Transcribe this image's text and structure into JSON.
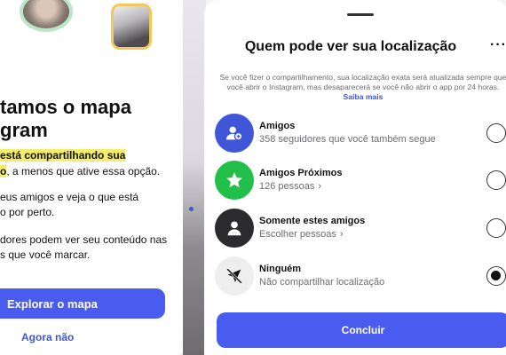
{
  "left_panel": {
    "title_line1": "tamos o mapa",
    "title_line2": "gram",
    "p1_highlight_1": "está compartilhando sua",
    "p1_highlight_2": "o",
    "p1_rest": ", a menos que ative essa opção.",
    "p2_line1": "eus amigos e veja o que está",
    "p2_line2": "o por perto.",
    "p3_line1": "dores podem ver seu conteúdo nas",
    "p3_line2": "s que você marcar.",
    "primary_button": "Explorar o mapa",
    "secondary_link": "Agora não"
  },
  "sheet": {
    "title": "Quem pode ver sua localização",
    "more_label": "···",
    "description": "Se você fizer o compartilhamento, sua localização exata será atualizada sempre que você abrir o Instagram, mas desaparecerá se você não abrir o app por 24 horas.",
    "learn_more": "Saiba mais",
    "options": [
      {
        "title": "Amigos",
        "subtitle": "358 seguidores que você também segue",
        "icon": "people-icon",
        "color": "#3f56d8",
        "selected": false
      },
      {
        "title": "Amigos Próximos",
        "subtitle": "126 pessoas",
        "chevron": "›",
        "icon": "star-icon",
        "color": "#22c04b",
        "selected": false
      },
      {
        "title": "Somente estes amigos",
        "subtitle": "Escolher pessoas",
        "chevron": "›",
        "icon": "person-icon",
        "color": "#2b2b2e",
        "selected": false
      },
      {
        "title": "Ninguém",
        "subtitle": "Não compartilhar localização",
        "icon": "location-off-icon",
        "color": "#eeeeef",
        "selected": true
      }
    ],
    "confirm_button": "Concluir"
  },
  "colors": {
    "accent": "#4a5cf0",
    "link": "#3f56d8",
    "highlight": "#f4ec6a"
  }
}
